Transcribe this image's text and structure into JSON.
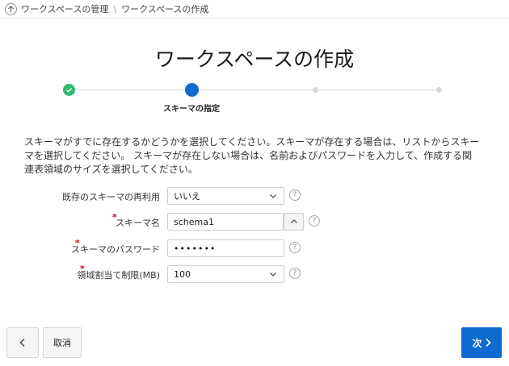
{
  "breadcrumb": {
    "items": [
      "ワークスペースの管理",
      "ワークスペースの作成"
    ],
    "separator": "\\"
  },
  "page": {
    "title": "ワークスペースの作成"
  },
  "steps": {
    "current_label": "スキーマの指定"
  },
  "description": "スキーマがすでに存在するかどうかを選択してください。スキーマが存在する場合は、リストからスキーマを選択してください。 スキーマが存在しない場合は、名前およびパスワードを入力して、作成する関連表領域のサイズを選択してください。",
  "form": {
    "reuse_schema": {
      "label": "既存のスキーマの再利用",
      "value": "いいえ"
    },
    "schema_name": {
      "label": "スキーマ名",
      "value": "schema1"
    },
    "schema_password": {
      "label": "スキーマのパスワード",
      "value": "•••••••"
    },
    "space_quota": {
      "label": "領域割当て制限(MB)",
      "value": "100"
    },
    "required_mark": "*",
    "help_glyph": "?"
  },
  "buttons": {
    "cancel": "取消",
    "next": "次"
  },
  "colors": {
    "primary": "#0d6acf",
    "done": "#2fba6f",
    "required": "#d4001a"
  }
}
